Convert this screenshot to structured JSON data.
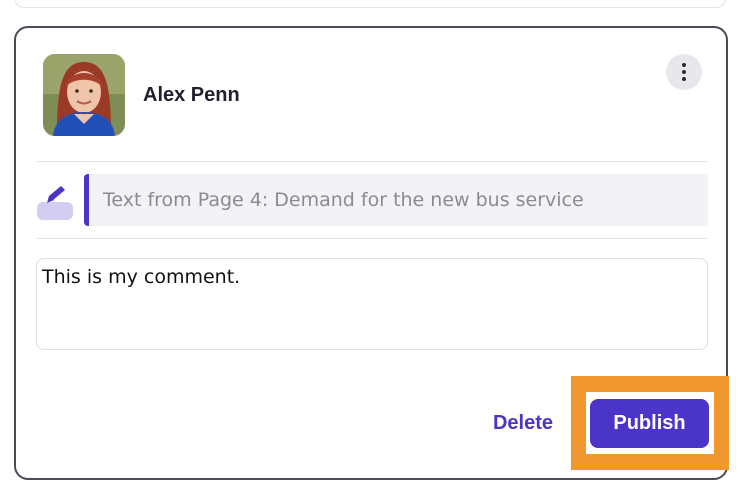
{
  "author": {
    "name": "Alex Penn"
  },
  "highlight": {
    "quote": "Text from Page 4: Demand for the new bus service",
    "accent_color": "#4a35c8"
  },
  "comment": {
    "value": "This is my comment."
  },
  "actions": {
    "delete_label": "Delete",
    "publish_label": "Publish",
    "primary_color": "#4a35c8",
    "focus_frame_color": "#f0972e"
  },
  "icons": {
    "more": "more-vertical-icon",
    "highlight": "highlighter-icon"
  }
}
